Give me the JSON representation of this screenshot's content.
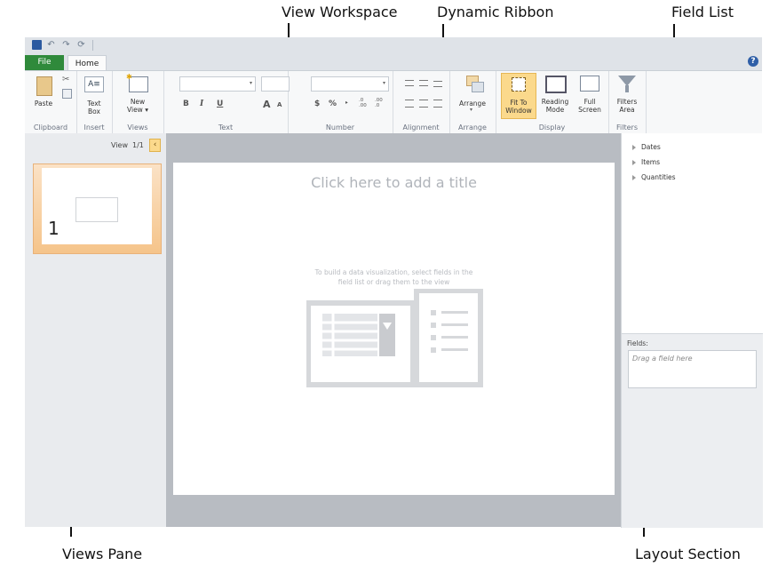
{
  "callouts": {
    "view_workspace": "View Workspace",
    "dynamic_ribbon": "Dynamic Ribbon",
    "field_list": "Field List",
    "views_pane": "Views Pane",
    "layout_section": "Layout Section"
  },
  "tabs": {
    "file": "File",
    "home": "Home"
  },
  "ribbon": {
    "clipboard": {
      "paste": "Paste",
      "group": "Clipboard"
    },
    "insert": {
      "text_box_1": "Text",
      "text_box_2": "Box",
      "group": "Insert"
    },
    "views": {
      "new_view_1": "New",
      "new_view_2": "View ▾",
      "group": "Views"
    },
    "text": {
      "bold": "B",
      "italic": "I",
      "underline": "U",
      "grow": "A",
      "shrink": "A",
      "group": "Text"
    },
    "number": {
      "currency": "$",
      "percent": "%",
      "comma": "‣",
      "inc_decimal": ".0 .00",
      "dec_decimal": ".00 .0",
      "group": "Number"
    },
    "alignment": {
      "group": "Alignment"
    },
    "arrange": {
      "label": "Arrange",
      "group": "Arrange"
    },
    "display": {
      "fit_1": "Fit To",
      "fit_2": "Window",
      "reading_1": "Reading",
      "reading_2": "Mode",
      "full_1": "Full",
      "full_2": "Screen",
      "group": "Display"
    },
    "filters": {
      "area_1": "Filters",
      "area_2": "Area",
      "group": "Filters"
    }
  },
  "views_pane": {
    "label": "View",
    "counter": "1/1",
    "thumb_number": "1"
  },
  "workspace": {
    "title_placeholder": "Click here to add a title",
    "hint_1": "To build a data visualization, select fields in the",
    "hint_2": "field list or drag them to the view"
  },
  "field_list": {
    "items": [
      "Dates",
      "Items",
      "Quantities"
    ]
  },
  "layout": {
    "fields_label": "Fields:",
    "drop_placeholder": "Drag a field here"
  },
  "colors": {
    "file_tab": "#2f8a3b",
    "accent_highlight": "#fbd98c",
    "thumb_gradient": "#f5c48a"
  }
}
